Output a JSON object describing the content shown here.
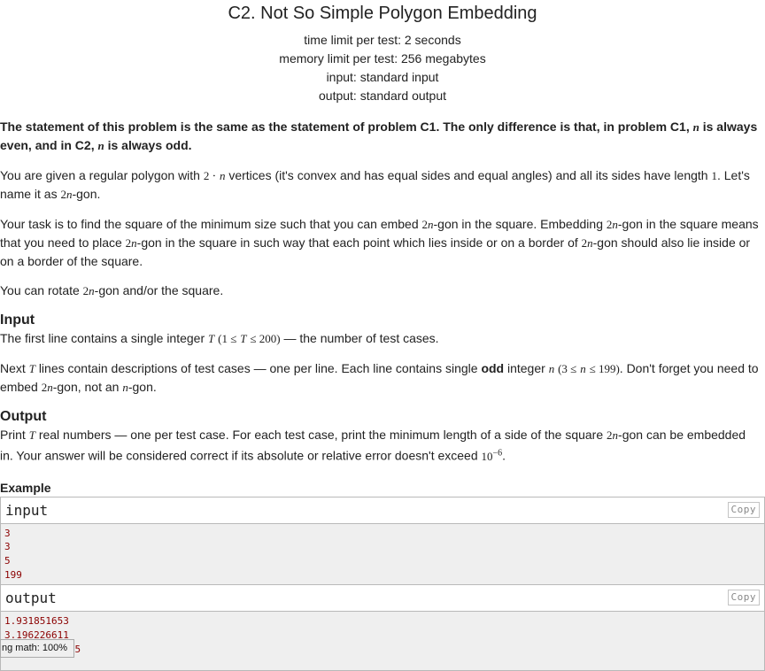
{
  "header": {
    "title": "C2. Not So Simple Polygon Embedding",
    "time_limit": "time limit per test: 2 seconds",
    "memory_limit": "memory limit per test: 256 megabytes",
    "input": "input: standard input",
    "output": "output: standard output"
  },
  "statement": {
    "lead": {
      "a": "The statement of this problem is the same as the statement of problem C1. The only difference is that, in problem C1,",
      "b": "is always even, and in C2,",
      "c": "is always odd."
    },
    "p1": {
      "a": "You are given a regular polygon with",
      "b": "vertices (it's convex and has equal sides and equal angles) and all its sides have length",
      "c": ". Let's name it as",
      "d": "-gon."
    },
    "p2": {
      "a": "Your task is to find the square of the minimum size such that you can embed",
      "b": "-gon in the square. Embedding",
      "c": "-gon in the square means that you need to place",
      "d": "-gon in the square in such way that each point which lies inside or on a border of",
      "e": "-gon should also lie inside or on a border of the square."
    },
    "p3": {
      "a": "You can rotate",
      "b": "-gon and/or the square."
    }
  },
  "input_section": {
    "heading": "Input",
    "p1": {
      "a": "The first line contains a single integer",
      "b": "— the number of test cases."
    },
    "p2": {
      "a": "Next",
      "b": "lines contain descriptions of test cases — one per line. Each line contains single",
      "odd": "odd",
      "c": "integer",
      "d": ". Don't forget you need to embed",
      "e": "-gon, not an",
      "f": "-gon."
    }
  },
  "output_section": {
    "heading": "Output",
    "p1": {
      "a": "Print",
      "b": "real numbers — one per test case. For each test case, print the minimum length of a side of the square",
      "c": "-gon can be embedded in. Your answer will be considered correct if its absolute or relative error doesn't exceed",
      "d": "."
    }
  },
  "math": {
    "n": "n",
    "T": "T",
    "two_dot_n_a": "2 ⋅",
    "one": "1",
    "two": "2",
    "T_range_a": "(1 ≤",
    "T_range_b": "≤ 200)",
    "n_range_a": "(3 ≤",
    "n_range_b": "≤ 199)",
    "ten": "10",
    "exp": "−6"
  },
  "example": {
    "heading": "Example",
    "input_label": "input",
    "output_label": "output",
    "copy_label": "Copy",
    "input_lines": [
      "3",
      "3",
      "5",
      "199"
    ],
    "output_lines": [
      "1.931851653",
      "3.196226611",
      "126.687663595"
    ]
  },
  "status": {
    "zoom": "ng math: 100%"
  },
  "colors": {
    "sample_text": "#8b0000",
    "sample_bg": "#efefef",
    "border": "#b9b9b9"
  }
}
